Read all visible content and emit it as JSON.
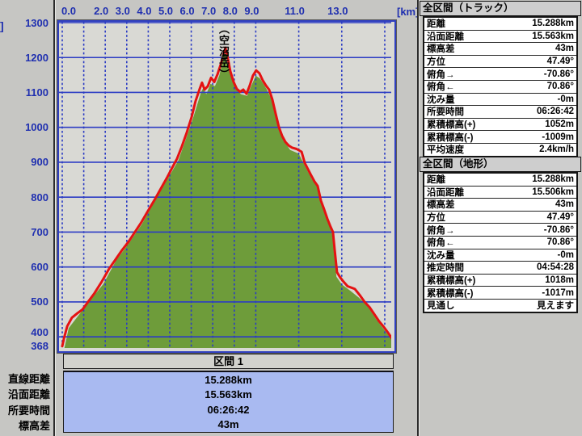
{
  "colors": {
    "window_bg": "#c6c6c3",
    "plot_bg": "#d9d9d4",
    "grid_blue": "#2c3cc4",
    "axis_text_blue": "#2030b0",
    "track_red": "#e41212",
    "terrain_green": "#6e9c3a",
    "peak_dot": "#3f4d22",
    "section_value_bg": "#a9baf1"
  },
  "chart": {
    "y_axis": {
      "unit_fragment": "]",
      "ticks": [
        1300,
        1200,
        1100,
        1000,
        900,
        800,
        700,
        600,
        500,
        400,
        368
      ]
    },
    "x_axis": {
      "unit": "[km]",
      "labels": [
        {
          "text": "0.0",
          "km": 0.0
        },
        {
          "text": "2.0",
          "km": 2.0
        },
        {
          "text": "3.0",
          "km": 3.0
        },
        {
          "text": "4.0",
          "km": 4.0
        },
        {
          "text": "5.0",
          "km": 5.0
        },
        {
          "text": "6.0",
          "km": 6.0
        },
        {
          "text": "7.0",
          "km": 7.0
        },
        {
          "text": "8.0",
          "km": 8.0
        },
        {
          "text": "9.0",
          "km": 9.0
        },
        {
          "text": "11.0",
          "km": 11.0
        },
        {
          "text": "13.0",
          "km": 13.0
        }
      ]
    },
    "peak_label": "（空沼岳）"
  },
  "chart_data": {
    "type": "area",
    "title": "トラック標高グラフ",
    "x_unit": "km",
    "y_unit": "m",
    "x_range": [
      0,
      15.38
    ],
    "y_range": [
      368,
      1300
    ],
    "x_gridlines_km": [
      0,
      1,
      2,
      3,
      4,
      5,
      6,
      7,
      8,
      9,
      11,
      13,
      15
    ],
    "y_gridlines_m": [
      400,
      500,
      600,
      700,
      800,
      900,
      1000,
      1100,
      1200,
      1300
    ],
    "peak_marker": {
      "km": 7.55,
      "m": 1202,
      "label": "（空沼岳）"
    },
    "series": [
      {
        "name": "terrain-profile",
        "style": "filled-area",
        "color": "#6e9c3a",
        "points": [
          [
            0.1,
            368
          ],
          [
            0.3,
            425
          ],
          [
            0.8,
            465
          ],
          [
            1.3,
            505
          ],
          [
            1.9,
            550
          ],
          [
            2.5,
            618
          ],
          [
            3.1,
            668
          ],
          [
            3.7,
            722
          ],
          [
            4.3,
            788
          ],
          [
            4.9,
            852
          ],
          [
            5.4,
            905
          ],
          [
            5.8,
            975
          ],
          [
            6.1,
            1030
          ],
          [
            6.45,
            1100
          ],
          [
            6.55,
            1112
          ],
          [
            6.7,
            1095
          ],
          [
            6.9,
            1125
          ],
          [
            7.1,
            1118
          ],
          [
            7.3,
            1148
          ],
          [
            7.55,
            1210
          ],
          [
            7.75,
            1165
          ],
          [
            8.0,
            1120
          ],
          [
            8.3,
            1095
          ],
          [
            8.6,
            1090
          ],
          [
            8.8,
            1120
          ],
          [
            9.0,
            1148
          ],
          [
            9.2,
            1140
          ],
          [
            9.5,
            1110
          ],
          [
            9.8,
            1072
          ],
          [
            10.0,
            1025
          ],
          [
            10.3,
            962
          ],
          [
            10.6,
            935
          ],
          [
            11.0,
            925
          ],
          [
            11.3,
            888
          ],
          [
            11.6,
            852
          ],
          [
            11.9,
            828
          ],
          [
            12.1,
            778
          ],
          [
            12.35,
            730
          ],
          [
            12.55,
            695
          ],
          [
            12.65,
            640
          ],
          [
            12.75,
            572
          ],
          [
            13.0,
            550
          ],
          [
            13.4,
            532
          ],
          [
            13.8,
            512
          ],
          [
            14.2,
            488
          ],
          [
            14.6,
            450
          ],
          [
            15.0,
            418
          ],
          [
            15.25,
            398
          ],
          [
            15.38,
            392
          ]
        ]
      },
      {
        "name": "gps-track",
        "style": "line",
        "color": "#e41212",
        "points": [
          [
            0,
            373
          ],
          [
            0.08,
            395
          ],
          [
            0.23,
            430
          ],
          [
            0.45,
            455
          ],
          [
            0.71,
            468
          ],
          [
            0.94,
            478
          ],
          [
            1.2,
            500
          ],
          [
            1.5,
            525
          ],
          [
            1.84,
            558
          ],
          [
            2.18,
            595
          ],
          [
            2.52,
            625
          ],
          [
            2.78,
            648
          ],
          [
            3.08,
            672
          ],
          [
            3.38,
            700
          ],
          [
            3.68,
            728
          ],
          [
            3.98,
            760
          ],
          [
            4.29,
            792
          ],
          [
            4.59,
            825
          ],
          [
            4.89,
            858
          ],
          [
            5.11,
            884
          ],
          [
            5.34,
            910
          ],
          [
            5.56,
            945
          ],
          [
            5.79,
            985
          ],
          [
            6.02,
            1030
          ],
          [
            6.2,
            1075
          ],
          [
            6.39,
            1110
          ],
          [
            6.5,
            1128
          ],
          [
            6.62,
            1108
          ],
          [
            6.77,
            1118
          ],
          [
            6.92,
            1142
          ],
          [
            7.07,
            1130
          ],
          [
            7.22,
            1152
          ],
          [
            7.37,
            1180
          ],
          [
            7.48,
            1205
          ],
          [
            7.59,
            1228
          ],
          [
            7.71,
            1195
          ],
          [
            7.82,
            1160
          ],
          [
            7.97,
            1130
          ],
          [
            8.12,
            1110
          ],
          [
            8.27,
            1102
          ],
          [
            8.42,
            1108
          ],
          [
            8.57,
            1096
          ],
          [
            8.72,
            1120
          ],
          [
            8.87,
            1148
          ],
          [
            9.02,
            1163
          ],
          [
            9.17,
            1155
          ],
          [
            9.32,
            1135
          ],
          [
            9.47,
            1120
          ],
          [
            9.62,
            1108
          ],
          [
            9.77,
            1080
          ],
          [
            9.92,
            1040
          ],
          [
            10.08,
            1000
          ],
          [
            10.23,
            975
          ],
          [
            10.38,
            958
          ],
          [
            10.53,
            948
          ],
          [
            10.68,
            942
          ],
          [
            10.9,
            938
          ],
          [
            11.13,
            930
          ],
          [
            11.28,
            898
          ],
          [
            11.43,
            880
          ],
          [
            11.58,
            862
          ],
          [
            11.73,
            845
          ],
          [
            11.88,
            832
          ],
          [
            12.03,
            790
          ],
          [
            12.18,
            765
          ],
          [
            12.33,
            738
          ],
          [
            12.48,
            715
          ],
          [
            12.59,
            700
          ],
          [
            12.67,
            650
          ],
          [
            12.78,
            585
          ],
          [
            12.93,
            570
          ],
          [
            13.08,
            558
          ],
          [
            13.27,
            545
          ],
          [
            13.61,
            537
          ],
          [
            13.83,
            520
          ],
          [
            14.06,
            500
          ],
          [
            14.29,
            485
          ],
          [
            14.51,
            465
          ],
          [
            14.74,
            444
          ],
          [
            14.96,
            428
          ],
          [
            15.15,
            412
          ],
          [
            15.34,
            395
          ],
          [
            15.38,
            382
          ]
        ]
      }
    ]
  },
  "section_table": {
    "header": "区間 1",
    "rows": [
      {
        "label": "直線距離",
        "value": "15.288km"
      },
      {
        "label": "沿面距離",
        "value": "15.563km"
      },
      {
        "label": "所要時間",
        "value": "06:26:42"
      },
      {
        "label": "標高差",
        "value": "43m"
      }
    ]
  },
  "panels": [
    {
      "title": "全区間（トラック）",
      "rows": [
        {
          "label": "距離",
          "value": "15.288km"
        },
        {
          "label": "沿面距離",
          "value": "15.563km"
        },
        {
          "label": "標高差",
          "value": "43m"
        },
        {
          "label": "方位",
          "value": "47.49°"
        },
        {
          "label": "俯角→",
          "value": "-70.86°"
        },
        {
          "label": "俯角←",
          "value": "70.86°"
        },
        {
          "label": "沈み量",
          "value": "-0m"
        },
        {
          "label": "所要時間",
          "value": "06:26:42"
        },
        {
          "label": "累積標高(+)",
          "value": "1052m"
        },
        {
          "label": "累積標高(-)",
          "value": "-1009m"
        },
        {
          "label": "平均速度",
          "value": "2.4km/h"
        }
      ]
    },
    {
      "title": "全区間（地形）",
      "rows": [
        {
          "label": "距離",
          "value": "15.288km"
        },
        {
          "label": "沿面距離",
          "value": "15.506km"
        },
        {
          "label": "標高差",
          "value": "43m"
        },
        {
          "label": "方位",
          "value": "47.49°"
        },
        {
          "label": "俯角→",
          "value": "-70.86°"
        },
        {
          "label": "俯角←",
          "value": "70.86°"
        },
        {
          "label": "沈み量",
          "value": "-0m"
        },
        {
          "label": "推定時間",
          "value": "04:54:28"
        },
        {
          "label": "累積標高(+)",
          "value": "1018m"
        },
        {
          "label": "累積標高(-)",
          "value": "-1017m"
        },
        {
          "label": "見通し",
          "value": "見えます"
        }
      ]
    }
  ]
}
